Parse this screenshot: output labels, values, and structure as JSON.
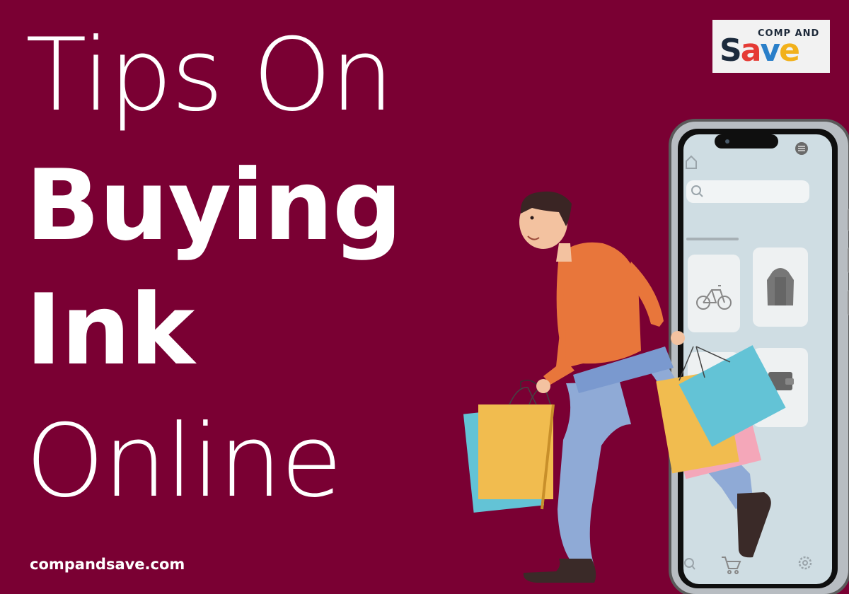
{
  "headline": {
    "line1": "Tips On",
    "line2": "Buying",
    "line3": "Ink",
    "line4": "Online"
  },
  "footer": {
    "url": "compandsave.com"
  },
  "logo": {
    "top_text": "COMP AND",
    "wordmark": [
      "S",
      "a",
      "v",
      "e"
    ]
  },
  "colors": {
    "background": "#7a0033",
    "text": "#ffffff",
    "logo_dark": "#1b2a3c",
    "logo_red": "#e53a34",
    "logo_blue": "#2a7fc9",
    "logo_yellow": "#f2b11b"
  },
  "illustration": {
    "phone_icons": [
      "home-icon",
      "menu-icon",
      "search-icon",
      "bicycle-icon",
      "hoodie-icon",
      "wallet-icon",
      "cart-icon",
      "gear-icon"
    ]
  }
}
